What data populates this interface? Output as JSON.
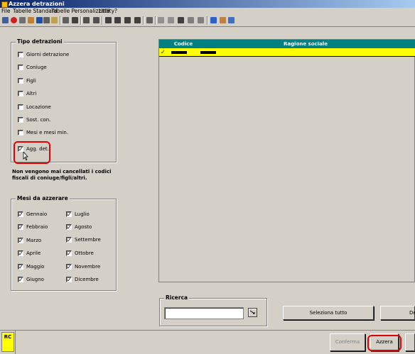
{
  "window": {
    "title": "Azzera detrazioni"
  },
  "menu": [
    "File",
    "Tabelle Standard",
    "Tabelle Personalizzate",
    "Utility",
    "?"
  ],
  "tipo": {
    "title": "Tipo detrazioni",
    "items": [
      {
        "label": "Giorni detrazione",
        "checked": false
      },
      {
        "label": "Coniuge",
        "checked": false
      },
      {
        "label": "Figli",
        "checked": false
      },
      {
        "label": "Altri",
        "checked": false
      },
      {
        "label": "Locazione",
        "checked": false
      },
      {
        "label": "Sost. con.",
        "checked": false
      },
      {
        "label": "Mesi e mesi min.",
        "checked": false
      },
      {
        "label": "Agg. det.",
        "checked": true
      }
    ]
  },
  "note": "Non vengono mai cancellati i codici fiscali di coniuge/figli/altri.",
  "mesi": {
    "title": "Mesi da azzerare",
    "col1": [
      {
        "label": "Gennaio",
        "checked": true
      },
      {
        "label": "Febbraio",
        "checked": true
      },
      {
        "label": "Marzo",
        "checked": true
      },
      {
        "label": "Aprile",
        "checked": true
      },
      {
        "label": "Maggio",
        "checked": true
      },
      {
        "label": "Giugno",
        "checked": true
      }
    ],
    "col2": [
      {
        "label": "Luglio",
        "checked": true
      },
      {
        "label": "Agosto",
        "checked": true
      },
      {
        "label": "Settembre",
        "checked": true
      },
      {
        "label": "Ottobre",
        "checked": true
      },
      {
        "label": "Novembre",
        "checked": true
      },
      {
        "label": "Dicembre",
        "checked": true
      }
    ]
  },
  "grid": {
    "columns": [
      "Codice",
      "Ragione sociale"
    ],
    "rows": [
      {
        "selected": true,
        "codice_redacted": true,
        "ragione_redacted": true
      }
    ]
  },
  "search": {
    "title": "Ricerca",
    "value": ""
  },
  "buttons": {
    "select_all": "Seleziona tutto",
    "deselect": "De",
    "confirm": "Conferma",
    "reset": "Azzera"
  },
  "status": {
    "indicator": "RC"
  },
  "colors": {
    "grid_header": "#008080",
    "row_selected": "#ffff00",
    "highlight": "#e60000"
  }
}
